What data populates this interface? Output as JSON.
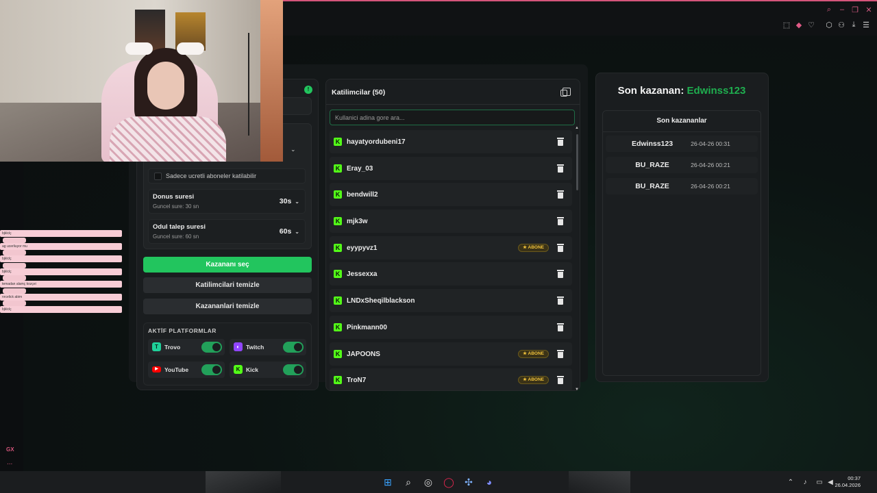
{
  "participants_panel": {
    "title": "Katilimcilar (50)",
    "search_placeholder": "Kullanici adina gore ara...",
    "items": [
      {
        "name": "hayatyordubeni17",
        "badge": ""
      },
      {
        "name": "Eray_03",
        "badge": ""
      },
      {
        "name": "bendwill2",
        "badge": ""
      },
      {
        "name": "mjk3w",
        "badge": ""
      },
      {
        "name": "eyypyvz1",
        "badge": "★ ABONE"
      },
      {
        "name": "Jessexxa",
        "badge": ""
      },
      {
        "name": "LNDxSheqilblackson",
        "badge": ""
      },
      {
        "name": "Pinkmann00",
        "badge": ""
      },
      {
        "name": "JAPOONS",
        "badge": "★ ABONE"
      },
      {
        "name": "TroN7",
        "badge": "★ ABONE"
      }
    ]
  },
  "settings_panel": {
    "subscriber_only_label": "Sadece ucretli aboneler katilabilir",
    "spin_timer": {
      "title": "Donus suresi",
      "subtitle": "Guncel sure: 30 sn",
      "value": "30s"
    },
    "claim_timer": {
      "title": "Odul talep suresi",
      "subtitle": "Guncel sure: 60 sn",
      "value": "60s"
    },
    "pick_winner_label": "Kazananı seç",
    "clear_participants_label": "Katilimcilari temizle",
    "clear_winners_label": "Kazananlari temizle",
    "platforms_header": "AKTİF PLATFORMLAR",
    "platforms": [
      {
        "name": "Trovo",
        "enabled": true,
        "color": "#1fd19a"
      },
      {
        "name": "Twitch",
        "enabled": true,
        "color": "#9146ff"
      },
      {
        "name": "YouTube",
        "enabled": true,
        "color": "#ff0000"
      },
      {
        "name": "Kick",
        "enabled": true,
        "color": "#53fc18"
      }
    ]
  },
  "winner_panel": {
    "last_winner_label": "Son kazanan:",
    "last_winner_name": "Edwinss123",
    "recent_title": "Son kazananlar",
    "recent": [
      {
        "name": "Edwinss123",
        "date": "26-04-26 00:31"
      },
      {
        "name": "BU_RAZE",
        "date": "26-04-26 00:21"
      },
      {
        "name": "BU_RAZE",
        "date": "26-04-26 00:21"
      }
    ]
  },
  "chat_overlay": {
    "lines": [
      "bjklclç",
      "ag ucerliuyor mu",
      "bjklclç",
      "bjklclç",
      "temadan alamç kozçei",
      "nrcelick abim",
      "bjklclç"
    ]
  },
  "browser": {
    "sidebar_logo": "GX",
    "sidebar_more": "..."
  },
  "taskbar": {
    "time": "00:37",
    "date": "26.04.2026"
  },
  "colors": {
    "accent_green": "#22c55e",
    "kick_green": "#53fc18",
    "opera_pink": "#d4557b",
    "winner_green": "#1fae4f"
  }
}
